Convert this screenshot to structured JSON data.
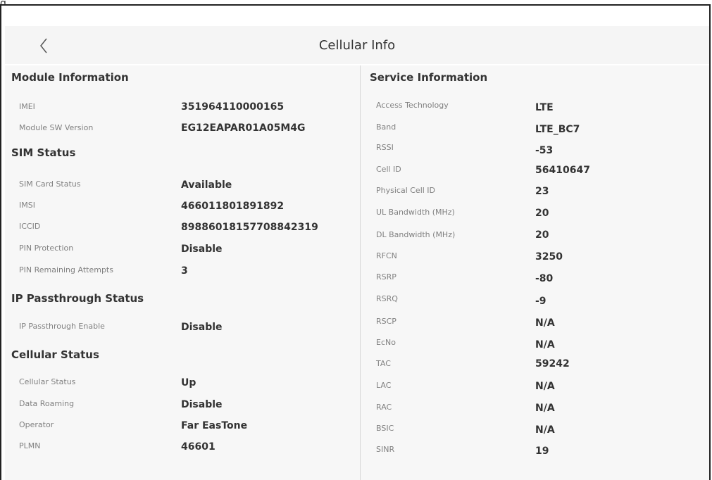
{
  "figure_label": "g",
  "header": {
    "title": "Cellular Info"
  },
  "left_sections": [
    {
      "title": "Module Information",
      "rows": [
        {
          "label": "IMEI",
          "value": "351964110000165"
        },
        {
          "label": "Module SW Version",
          "value": "EG12EAPAR01A05M4G"
        }
      ]
    },
    {
      "title": "SIM Status",
      "rows": [
        {
          "label": "SIM Card Status",
          "value": "Available"
        },
        {
          "label": "IMSI",
          "value": "466011801891892"
        },
        {
          "label": "ICCID",
          "value": "89886018157708842319"
        },
        {
          "label": "PIN Protection",
          "value": "Disable"
        },
        {
          "label": "PIN Remaining Attempts",
          "value": "3"
        }
      ]
    },
    {
      "title": "IP Passthrough Status",
      "rows": [
        {
          "label": "IP Passthrough Enable",
          "value": "Disable"
        }
      ]
    },
    {
      "title": "Cellular Status",
      "rows": [
        {
          "label": "Cellular Status",
          "value": "Up"
        },
        {
          "label": "Data Roaming",
          "value": "Disable"
        },
        {
          "label": "Operator",
          "value": "Far EasTone"
        },
        {
          "label": "PLMN",
          "value": "46601"
        }
      ]
    }
  ],
  "service": {
    "title": "Service Information",
    "rows": [
      {
        "label": "Access Technology",
        "value": "LTE"
      },
      {
        "label": "Band",
        "value": "LTE_BC7"
      },
      {
        "label": "RSSI",
        "value": "-53"
      },
      {
        "label": "Cell ID",
        "value": "56410647"
      },
      {
        "label": "Physical Cell ID",
        "value": "23"
      },
      {
        "label": "UL Bandwidth (MHz)",
        "value": "20"
      },
      {
        "label": "DL Bandwidth (MHz)",
        "value": "20"
      },
      {
        "label": "RFCN",
        "value": "3250"
      },
      {
        "label": "RSRP",
        "value": "-80"
      },
      {
        "label": "RSRQ",
        "value": "-9"
      },
      {
        "label": "RSCP",
        "value": "N/A"
      },
      {
        "label": "EcNo",
        "value": "N/A"
      },
      {
        "label": "TAC",
        "value": "59242"
      },
      {
        "label": "LAC",
        "value": "N/A"
      },
      {
        "label": "RAC",
        "value": "N/A"
      },
      {
        "label": "BSIC",
        "value": "N/A"
      },
      {
        "label": "SINR",
        "value": "19"
      }
    ]
  },
  "icons": {
    "back": "chevron-left-icon"
  }
}
